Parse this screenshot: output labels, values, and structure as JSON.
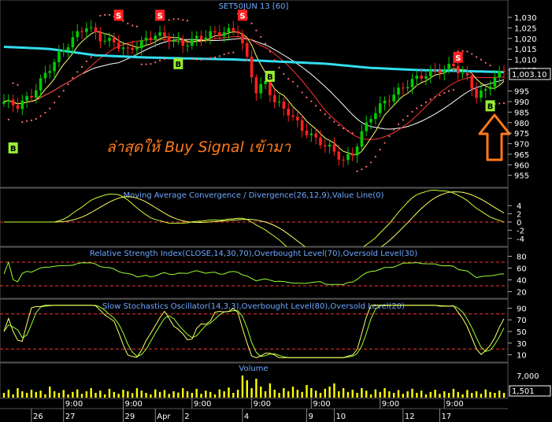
{
  "chart_title": "SET50JUN 13   [60]",
  "colors": {
    "background": "#000000",
    "up": "#00cc00",
    "down": "#ff2020",
    "ma_long": "#33ddee",
    "ma_mid": "#ffffff",
    "ma_short": "#ffff66",
    "ma_red": "#ff3333",
    "sar": "#ff7070",
    "macd": "#ccff33",
    "signal": "#ffff66",
    "rsi": "#99ff33",
    "stoch_k": "#ffff66",
    "stoch_d": "#99ff33",
    "level": "#ff3333",
    "volume": "#ffff00",
    "buy": "#99ee33",
    "sell": "#ff2222",
    "annotation": "#ff7a1a",
    "pane_title": "#6fa8ff"
  },
  "annotation": {
    "text": "ล่าสุดให้ Buy Signal เข้ามา",
    "arrow_icon": "up-arrow-icon"
  },
  "price_axis": {
    "ticks": [
      "1,030",
      "1,025",
      "1,020",
      "1,015",
      "1,010",
      "1,005",
      "995",
      "990",
      "985",
      "980",
      "975",
      "970",
      "965",
      "960",
      "955"
    ],
    "last_price": "1,003.10"
  },
  "signals": {
    "buy": [
      {
        "bar": 2,
        "price": 968
      },
      {
        "bar": 38,
        "price": 1008
      },
      {
        "bar": 58,
        "price": 1002
      },
      {
        "bar": 106,
        "price": 988
      }
    ],
    "sell": [
      {
        "bar": 25,
        "price": 1031
      },
      {
        "bar": 34,
        "price": 1031
      },
      {
        "bar": 52,
        "price": 1031
      },
      {
        "bar": 99,
        "price": 1011
      }
    ],
    "buy_label": "B",
    "sell_label": "S"
  },
  "macd_pane": {
    "title": "Moving Average Convergence / Divergence(26,12,9),Value Line(0)",
    "ticks": [
      "4",
      "2",
      "0",
      "-2",
      "-4"
    ],
    "value_line": 0,
    "range": [
      -5,
      5
    ]
  },
  "rsi_pane": {
    "title": "Relative Strength Index(CLOSE,14,30,70),Overbought Level(70),Oversold Level(30)",
    "ticks": [
      "80",
      "60",
      "40",
      "20"
    ],
    "overbought": 70,
    "oversold": 30,
    "range": [
      10,
      90
    ]
  },
  "stoch_pane": {
    "title": "Slow Stochastics Oscillator(14,3,3),Overbought Level(80),Oversold Level(20)",
    "ticks": [
      "90",
      "70",
      "50",
      "30",
      "10"
    ],
    "overbought": 80,
    "oversold": 20,
    "range": [
      0,
      100
    ]
  },
  "volume_pane": {
    "title": "Volume",
    "ticks": [
      "7,000"
    ],
    "last_value": "1,501",
    "range": [
      0,
      8000
    ]
  },
  "time_axis": {
    "top_labels": [
      {
        "bar": 13,
        "text": "9:00"
      },
      {
        "bar": 26,
        "text": "9:00"
      },
      {
        "bar": 41,
        "text": "9:00"
      },
      {
        "bar": 54,
        "text": "9:00"
      },
      {
        "bar": 67,
        "text": "9:00"
      },
      {
        "bar": 82,
        "text": "9:00"
      },
      {
        "bar": 96,
        "text": "9:00"
      }
    ],
    "bottom_labels": [
      {
        "bar": 6,
        "text": "26"
      },
      {
        "bar": 13,
        "text": "27"
      },
      {
        "bar": 26,
        "text": "29"
      },
      {
        "bar": 33,
        "text": "Apr"
      },
      {
        "bar": 39,
        "text": "2"
      },
      {
        "bar": 52,
        "text": "4"
      },
      {
        "bar": 66,
        "text": "9"
      },
      {
        "bar": 72,
        "text": "10"
      },
      {
        "bar": 87,
        "text": "12"
      },
      {
        "bar": 95,
        "text": "17"
      }
    ]
  },
  "chart_data": {
    "type": "candlestick",
    "title": "SET50JUN 13   [60]",
    "ylim": [
      953,
      1033
    ],
    "bars": 110,
    "series": [
      {
        "name": "SET50JUN 13",
        "kind": "close_path",
        "points": [
          [
            0,
            990
          ],
          [
            3,
            988
          ],
          [
            6,
            993
          ],
          [
            9,
            1003
          ],
          [
            12,
            1012
          ],
          [
            15,
            1020
          ],
          [
            18,
            1026
          ],
          [
            21,
            1020
          ],
          [
            24,
            1018
          ],
          [
            27,
            1014
          ],
          [
            30,
            1018
          ],
          [
            33,
            1022
          ],
          [
            36,
            1020
          ],
          [
            39,
            1017
          ],
          [
            42,
            1020
          ],
          [
            45,
            1022
          ],
          [
            48,
            1023
          ],
          [
            51,
            1024
          ],
          [
            53,
            1010
          ],
          [
            55,
            995
          ],
          [
            57,
            999
          ],
          [
            59,
            990
          ],
          [
            62,
            985
          ],
          [
            65,
            977
          ],
          [
            68,
            972
          ],
          [
            71,
            968
          ],
          [
            74,
            962
          ],
          [
            76,
            965
          ],
          [
            78,
            975
          ],
          [
            80,
            983
          ],
          [
            83,
            990
          ],
          [
            86,
            995
          ],
          [
            89,
            1000
          ],
          [
            92,
            1003
          ],
          [
            95,
            1005
          ],
          [
            98,
            1007
          ],
          [
            101,
            1001
          ],
          [
            103,
            993
          ],
          [
            105,
            995
          ],
          [
            107,
            1002
          ],
          [
            109,
            1004
          ]
        ]
      },
      {
        "name": "Long MA",
        "kind": "line",
        "points": [
          [
            0,
            1016
          ],
          [
            10,
            1015
          ],
          [
            20,
            1012
          ],
          [
            30,
            1011
          ],
          [
            40,
            1010.5
          ],
          [
            50,
            1010
          ],
          [
            60,
            1009
          ],
          [
            70,
            1008
          ],
          [
            80,
            1006
          ],
          [
            90,
            1005
          ],
          [
            100,
            1004.5
          ],
          [
            109,
            1004
          ]
        ]
      }
    ],
    "volume": [
      1500,
      2500,
      1000,
      3000,
      2000,
      1500,
      2500,
      1800,
      2200,
      1000,
      3500,
      2000,
      1500,
      2400,
      1000,
      1800,
      2600,
      1200,
      2000,
      3000,
      1500,
      2200,
      1000,
      2800,
      1800,
      1200,
      2500,
      2000,
      1400,
      3000,
      2200,
      1500,
      1000,
      2600,
      1800,
      2400,
      1200,
      2000,
      1600,
      3000,
      2000,
      1500,
      2800,
      1200,
      2200,
      1800,
      1000,
      2600,
      2000,
      3200,
      1500,
      2500,
      7000,
      5500,
      3000,
      6000,
      3500,
      2000,
      4500,
      2500,
      1500,
      3000,
      2000,
      3500,
      2500,
      1800,
      4000,
      3000,
      2200,
      1500,
      2800,
      3500,
      4500,
      2000,
      3000,
      1800,
      2500,
      1500,
      3000,
      2200,
      1000,
      2600,
      1800,
      3000,
      2000,
      1500,
      2400,
      1200,
      2000,
      2800,
      1500,
      2200,
      1000,
      1800,
      2500,
      1200,
      2000,
      1500,
      2800,
      1800,
      1000,
      2400,
      1500,
      2000,
      1200,
      2600,
      1800,
      1500,
      2200,
      1501
    ]
  }
}
